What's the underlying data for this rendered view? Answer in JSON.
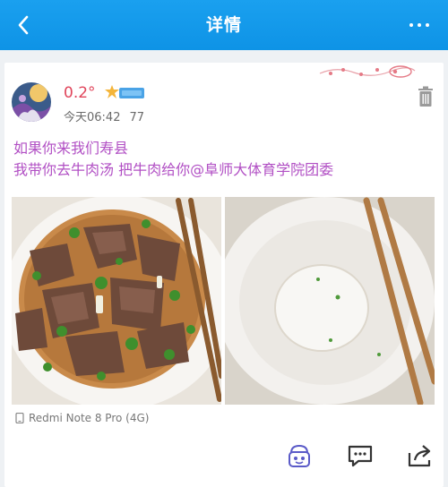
{
  "header": {
    "title": "详情",
    "back_icon": "chevron-left-icon",
    "more_icon": "more-horizontal-icon"
  },
  "post": {
    "username": "0.2°",
    "time": "今天06:42",
    "views": "77",
    "lines": [
      "如果你来我们寿县",
      "我带你去牛肉汤 把牛肉给你@阜师大体育学院团委"
    ],
    "device": "Redmi Note 8 Pro (4G)"
  },
  "colors": {
    "header": "#1aa0ef",
    "username": "#e0455b",
    "post_text": "#b14fc4"
  }
}
